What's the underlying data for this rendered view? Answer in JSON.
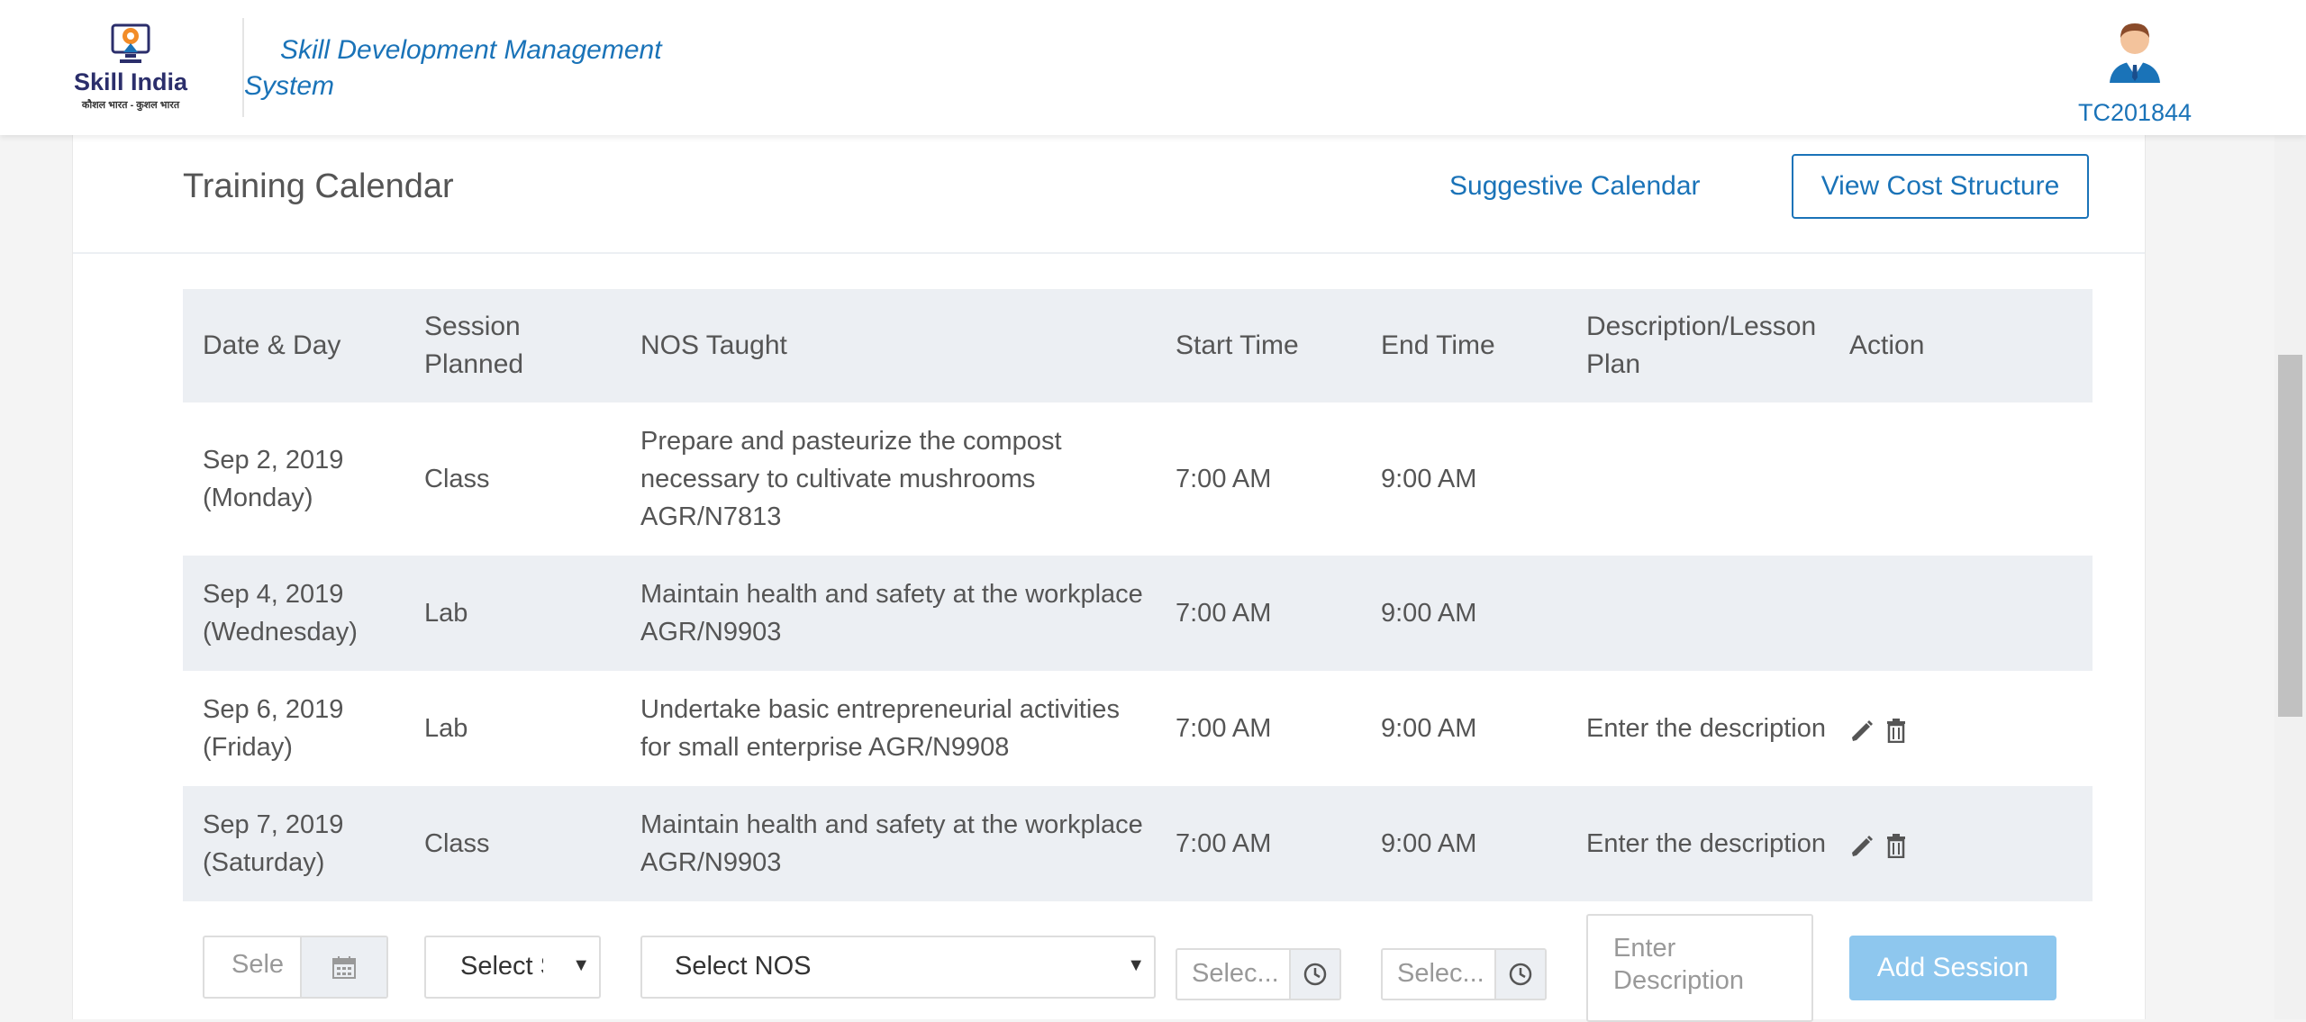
{
  "header": {
    "logo_wordmark": "Skill India",
    "logo_tagline": "कौशल भारत - कुशल भारत",
    "app_title": "Skill Development Management System",
    "user_id": "TC201844"
  },
  "card": {
    "title": "Training Calendar",
    "suggestive_link": "Suggestive Calendar",
    "view_cost_button": "View Cost Structure"
  },
  "table": {
    "columns": [
      "Date & Day",
      "Session Planned",
      "NOS Taught",
      "Start Time",
      "End Time",
      "Description/Lesson Plan",
      "Action"
    ],
    "rows": [
      {
        "date": "Sep 2, 2019 (Monday)",
        "session": "Class",
        "nos": "Prepare and pasteurize the compost necessary to cultivate mushrooms AGR/N7813",
        "start": "7:00 AM",
        "end": "9:00 AM",
        "description": "",
        "actions": false
      },
      {
        "date": "Sep 4, 2019 (Wednesday)",
        "session": "Lab",
        "nos": "Maintain health and safety at the workplace AGR/N9903",
        "start": "7:00 AM",
        "end": "9:00 AM",
        "description": "",
        "actions": false
      },
      {
        "date": "Sep 6, 2019 (Friday)",
        "session": "Lab",
        "nos": "Undertake basic entrepreneurial activities for small enterprise AGR/N9908",
        "start": "7:00 AM",
        "end": "9:00 AM",
        "description": "Enter the description",
        "actions": true
      },
      {
        "date": "Sep 7, 2019 (Saturday)",
        "session": "Class",
        "nos": "Maintain health and safety at the workplace AGR/N9903",
        "start": "7:00 AM",
        "end": "9:00 AM",
        "description": "Enter the description",
        "actions": true
      }
    ]
  },
  "form": {
    "date_placeholder": "Sele",
    "session_select": "Select S",
    "nos_select": "Select NOS",
    "start_placeholder": "Selec...",
    "end_placeholder": "Selec...",
    "description_placeholder": "Enter Description",
    "add_button": "Add Session"
  },
  "colors": {
    "brand_blue": "#1a73b8",
    "header_row_bg": "#eceff3",
    "add_button_bg": "#8ec7ee"
  },
  "icons": {
    "edit": "pencil-icon",
    "delete": "trash-icon",
    "calendar": "calendar-icon",
    "clock": "clock-icon"
  }
}
